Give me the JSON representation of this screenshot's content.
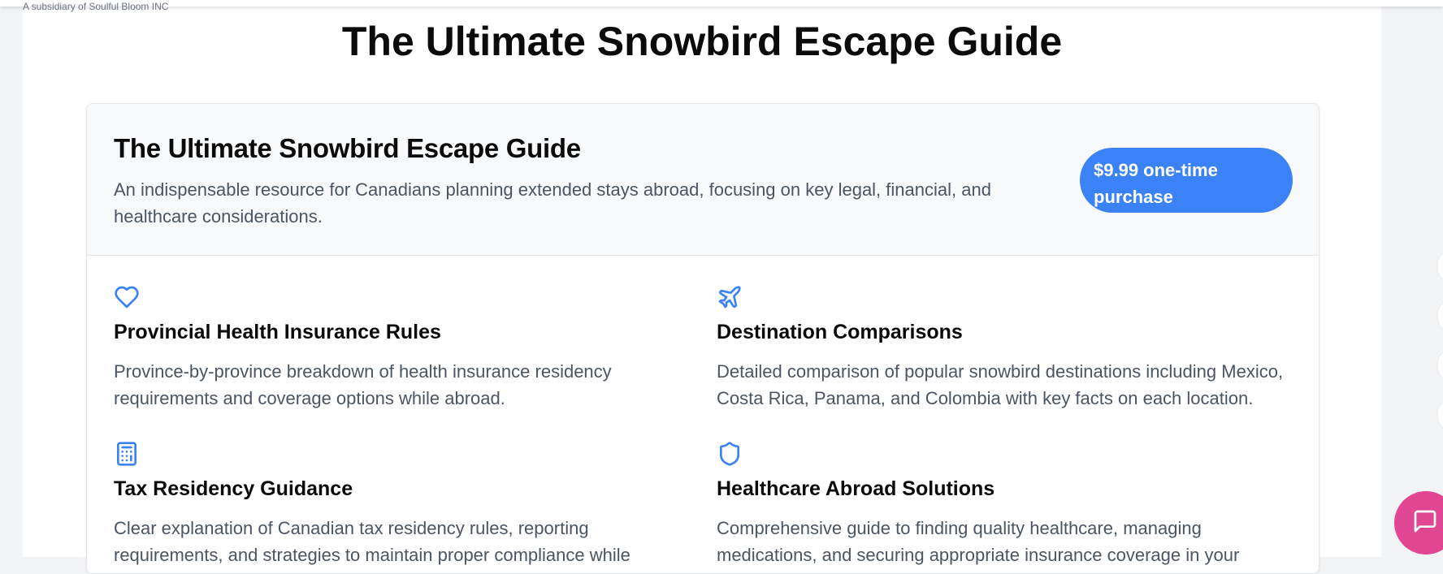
{
  "brand": {
    "subsidiary_text": "A subsidiary of Soulful Bloom INC"
  },
  "page": {
    "title": "The Ultimate Snowbird Escape Guide"
  },
  "product": {
    "title": "The Ultimate Snowbird Escape Guide",
    "description": "An indispensable resource for Canadians planning extended stays abroad, focusing on key legal, financial, and healthcare considerations.",
    "price_label": "$9.99 one-time purchase"
  },
  "features": [
    {
      "icon": "heart-icon",
      "title": "Provincial Health Insurance Rules",
      "description": "Province-by-province breakdown of health insurance residency requirements and coverage options while abroad."
    },
    {
      "icon": "plane-icon",
      "title": "Destination Comparisons",
      "description": "Detailed comparison of popular snowbird destinations including Mexico, Costa Rica, Panama, and Colombia with key facts on each location."
    },
    {
      "icon": "calculator-icon",
      "title": "Tax Residency Guidance",
      "description": "Clear explanation of Canadian tax residency rules, reporting requirements, and strategies to maintain proper compliance while"
    },
    {
      "icon": "shield-icon",
      "title": "Healthcare Abroad Solutions",
      "description": "Comprehensive guide to finding quality healthcare, managing medications, and securing appropriate insurance coverage in your"
    }
  ],
  "widgets": {
    "chat_icon": "chat-bubble-icon"
  },
  "colors": {
    "accent": "#3b82f6",
    "chat": "#e04691",
    "header_bg": "#f8f9fb",
    "body_text": "#4b5563"
  }
}
